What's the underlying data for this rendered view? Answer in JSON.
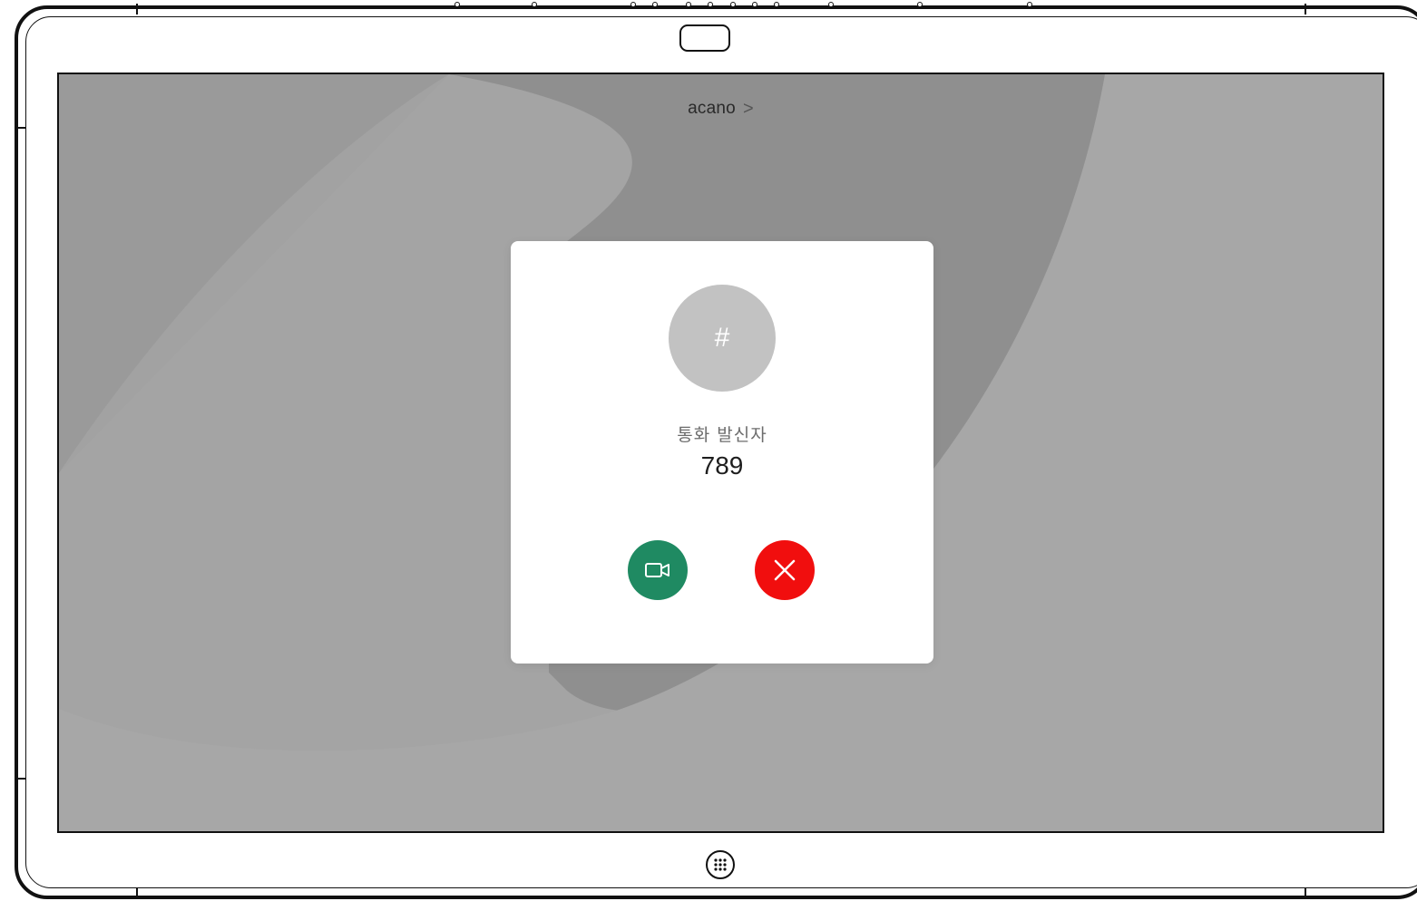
{
  "header": {
    "room_name": "acano",
    "chevron": ">"
  },
  "incoming_call": {
    "avatar_glyph": "#",
    "label": "통화 발신자",
    "number": "789",
    "answer_icon": "video-camera-icon",
    "decline_icon": "close-icon"
  },
  "device": {
    "home_icon": "keypad-grid-icon"
  },
  "colors": {
    "answer": "#1f8a62",
    "decline": "#f10e0e",
    "avatar": "#c2c2c2",
    "background": "#a3a3a3"
  }
}
